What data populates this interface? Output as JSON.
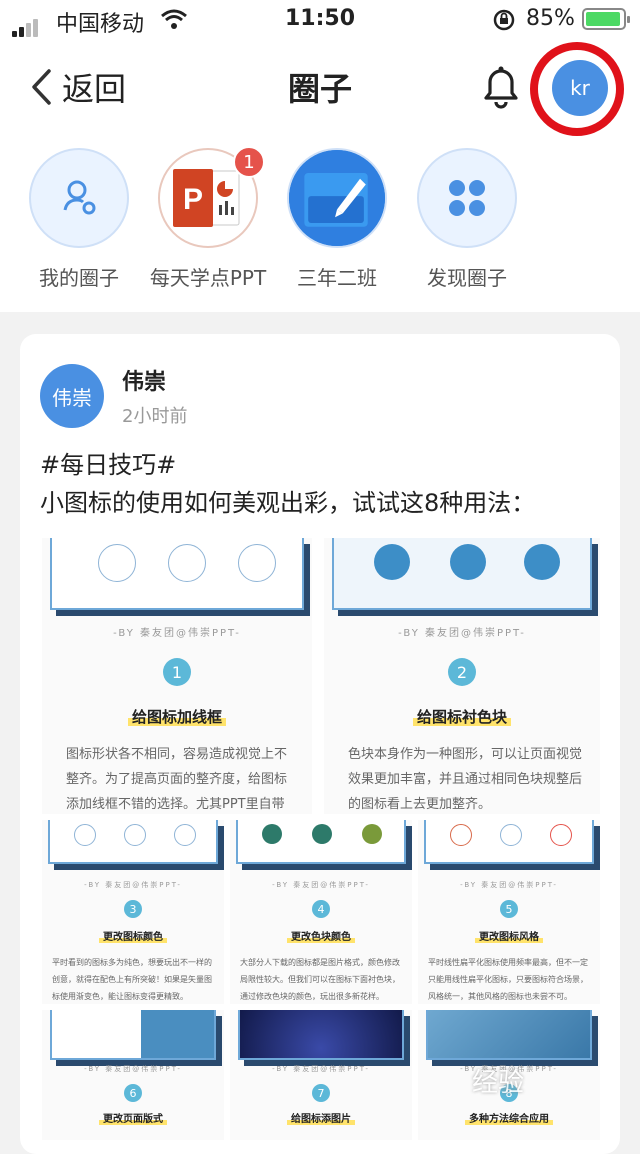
{
  "status": {
    "carrier": "中国移动",
    "time": "11:50",
    "battery": "85%"
  },
  "nav": {
    "back_label": "返回",
    "title": "圈子",
    "avatar_text": "kr"
  },
  "circles": [
    {
      "label": "我的圈子"
    },
    {
      "label": "每天学点PPT",
      "badge": "1"
    },
    {
      "label": "三年二班"
    },
    {
      "label": "发现圈子"
    }
  ],
  "post": {
    "avatar_text": "伟崇",
    "author": "伟崇",
    "time": "2小时前",
    "line1": "#每日技巧#",
    "line2": "小图标的使用如何美观出彩，试试这8种用法："
  },
  "images": [
    {
      "num": "1",
      "by": "-BY 秦友团@伟崇PPT-",
      "title": "给图标加线框",
      "desc": "图标形状各不相同，容易造成视觉上不整齐。为了提高页面的整齐度，给图标添加线框不错的选择。尤其PPT里自带了上百种形状，"
    },
    {
      "num": "2",
      "by": "-BY 秦友团@伟崇PPT-",
      "title": "给图标衬色块",
      "desc": "色块本身作为一种图形，可以让页面视觉效果更加丰富，并且通过相同色块规整后的图标看上去更加整齐。"
    },
    {
      "num": "3",
      "by": "-BY 秦友团@伟崇PPT-",
      "title": "更改图标颜色",
      "desc": "平时看到的图标多为纯色，想要玩出不一样的创意，就得在配色上有所突破！如果是矢量图标使用渐变色，能让图标变得更精致。"
    },
    {
      "num": "4",
      "by": "-BY 秦友团@伟崇PPT-",
      "title": "更改色块颜色",
      "desc": "大部分人下载的图标都是图片格式，颜色修改局限性较大。但我们可以在图标下面衬色块，通过修改色块的颜色，玩出很多新花样。"
    },
    {
      "num": "5",
      "by": "-BY 秦友团@伟崇PPT-",
      "title": "更改图标风格",
      "desc": "平时线性扁平化图标使用频率最高，但不一定只能用线性扁平化图标，只要图标符合场景，风格统一，其他风格的图标也未尝不可。"
    },
    {
      "num": "6",
      "by": "-BY 秦友团@伟崇PPT-",
      "title": "更改页面版式"
    },
    {
      "num": "7",
      "by": "-BY 秦友团@伟崇PPT-",
      "title": "给图标添图片"
    },
    {
      "num": "8",
      "by": "-BY 秦友团@伟崇PPT-",
      "title": "多种方法综合应用"
    }
  ],
  "watermark": "经验"
}
